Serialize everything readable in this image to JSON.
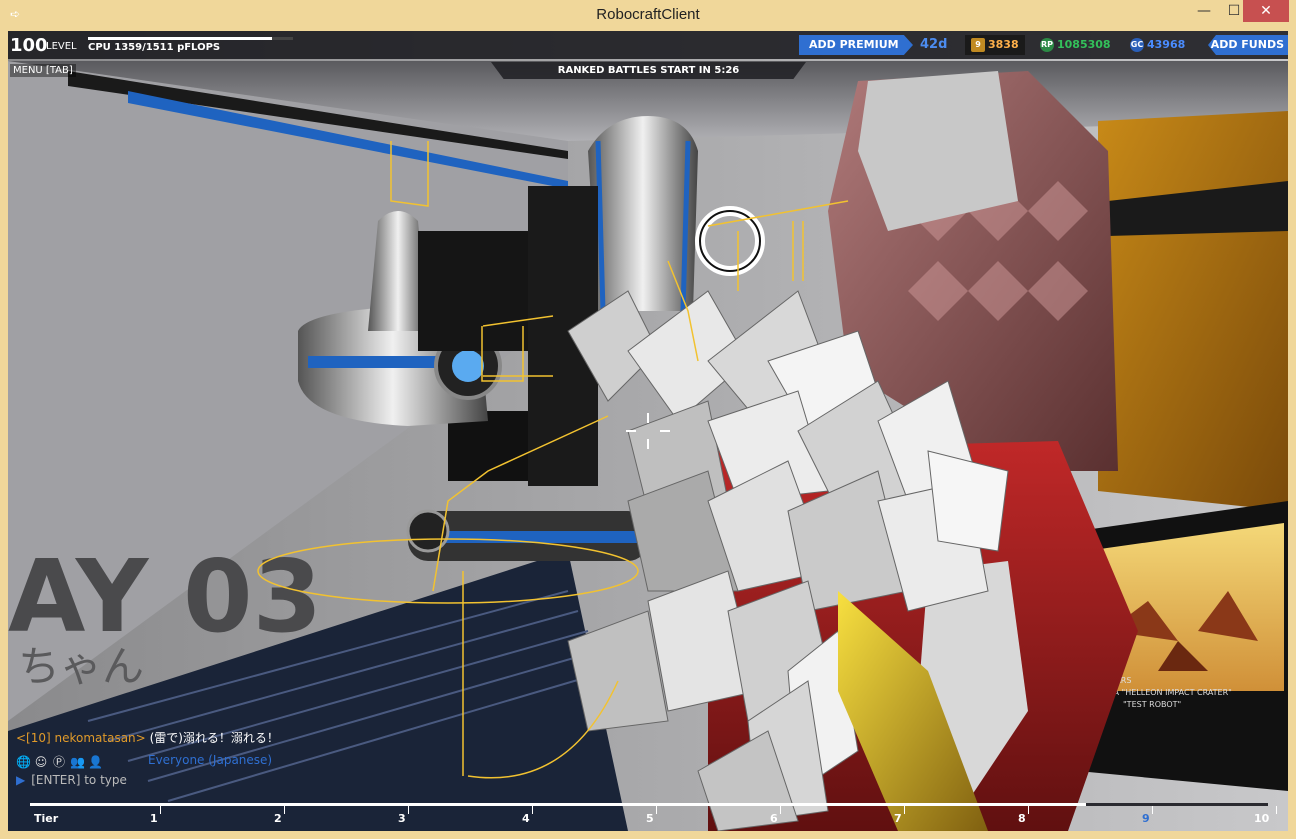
{
  "window": {
    "title": "RobocraftClient",
    "min_glyph": "—",
    "max_glyph": "☐",
    "close_glyph": "✕"
  },
  "hud": {
    "level_num": "100",
    "level_label": "LEVEL",
    "cpu_text": "CPU 1359/1511 pFLOPS",
    "cpu_used": 1359,
    "cpu_max": 1511,
    "menu_tab": "MENU [TAB]",
    "ranked_banner": "RANKED BATTLES START IN 5:26",
    "add_premium": "ADD PREMIUM",
    "premium_days": "42d",
    "rank_value": "3838",
    "rank_icon_text": "9",
    "rp_value": "1085308",
    "rp_icon_text": "RP",
    "gc_value": "43968",
    "gc_icon_text": "GC",
    "add_funds": "ADD FUNDS"
  },
  "scene": {
    "wall_text_1": "AY 03",
    "wall_text_2": "ちゃん",
    "screen_caption_1": "- MARS",
    "screen_caption_2": "- 2A \"HELLEON IMPACT CRATER\"",
    "screen_caption_3": "\"TEST ROBOT\""
  },
  "chat": {
    "user": "<[10] nekomatasan>",
    "message": "(雷で)溺れる！溺れる！",
    "channel": "Everyone (Japanese)",
    "input_placeholder": "[ENTER] to type"
  },
  "tier_bar": {
    "label": "Tier",
    "ticks": [
      "1",
      "2",
      "3",
      "4",
      "5",
      "6",
      "7",
      "8",
      "9",
      "10"
    ],
    "progress": 0.853
  },
  "colors": {
    "accent_blue": "#2f6fd1",
    "rank_orange": "#ffb04a",
    "rp_green": "#33c05a",
    "gc_blue": "#4a8cff",
    "outline_yellow": "#f2c230"
  }
}
